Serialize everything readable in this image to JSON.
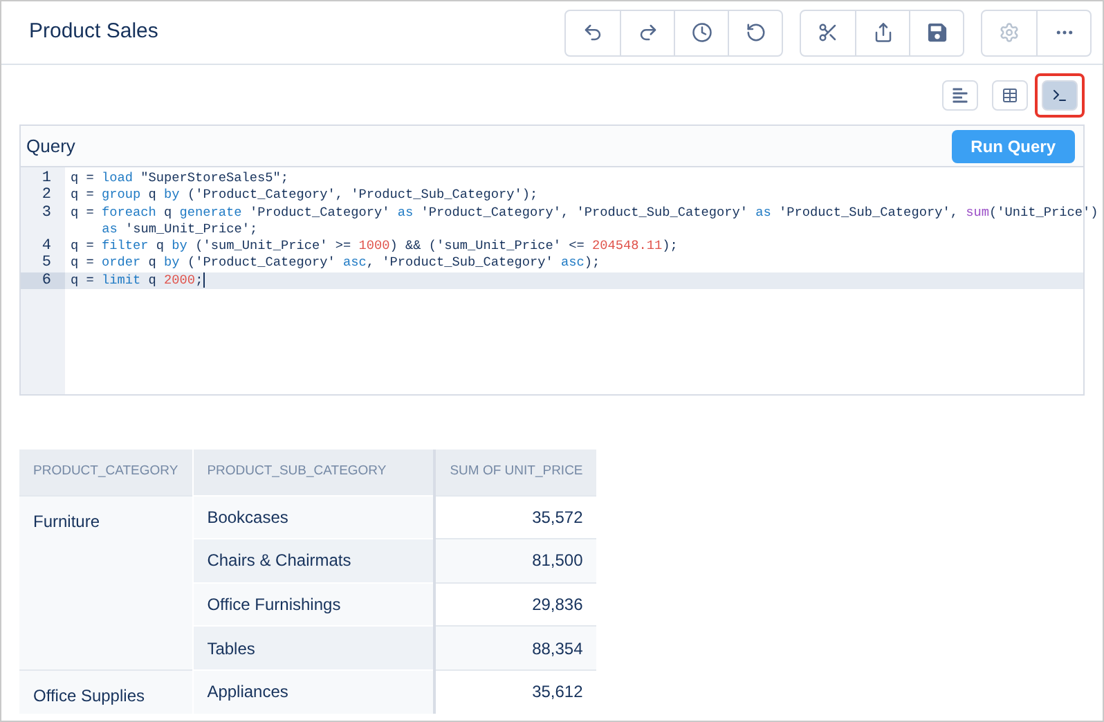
{
  "header": {
    "title": "Product Sales",
    "toolbar_groups": [
      [
        {
          "kind": "undo",
          "disabled": false
        },
        {
          "kind": "redo",
          "disabled": false
        },
        {
          "kind": "history",
          "disabled": false
        },
        {
          "kind": "revert",
          "disabled": false
        }
      ],
      [
        {
          "kind": "cut",
          "disabled": false
        },
        {
          "kind": "share",
          "disabled": false
        },
        {
          "kind": "save",
          "disabled": false
        }
      ],
      [
        {
          "kind": "settings",
          "disabled": true
        },
        {
          "kind": "more",
          "disabled": false
        }
      ]
    ]
  },
  "view_buttons": [
    {
      "kind": "chart",
      "selected": false,
      "highlighted": false
    },
    {
      "kind": "table",
      "selected": false,
      "highlighted": false
    },
    {
      "kind": "query",
      "selected": true,
      "highlighted": true
    }
  ],
  "query": {
    "title": "Query",
    "run_button": "Run Query",
    "lines": [
      {
        "number": "1",
        "active": false,
        "tokens": [
          {
            "text": "q = ",
            "kind": "plain"
          },
          {
            "text": "load",
            "kind": "keyword"
          },
          {
            "text": " \"SuperStoreSales5\";",
            "kind": "plain"
          }
        ]
      },
      {
        "number": "2",
        "active": false,
        "tokens": [
          {
            "text": "q = ",
            "kind": "plain"
          },
          {
            "text": "group",
            "kind": "keyword"
          },
          {
            "text": " q ",
            "kind": "plain"
          },
          {
            "text": "by",
            "kind": "keyword"
          },
          {
            "text": " ('Product_Category', 'Product_Sub_Category');",
            "kind": "plain"
          }
        ]
      },
      {
        "number": "3",
        "active": false,
        "tokens": [
          {
            "text": "q = ",
            "kind": "plain"
          },
          {
            "text": "foreach",
            "kind": "keyword"
          },
          {
            "text": " q ",
            "kind": "plain"
          },
          {
            "text": "generate",
            "kind": "keyword"
          },
          {
            "text": " 'Product_Category' ",
            "kind": "plain"
          },
          {
            "text": "as",
            "kind": "keyword"
          },
          {
            "text": " 'Product_Category', 'Product_Sub_Category' ",
            "kind": "plain"
          },
          {
            "text": "as",
            "kind": "keyword"
          },
          {
            "text": " 'Product_Sub_Category', ",
            "kind": "plain"
          },
          {
            "text": "sum",
            "kind": "function"
          },
          {
            "text": "('Unit_Price')",
            "kind": "plain"
          }
        ],
        "wrapped_tokens": [
          {
            "text": "as",
            "kind": "keyword"
          },
          {
            "text": " 'sum_Unit_Price';",
            "kind": "plain"
          }
        ]
      },
      {
        "number": "4",
        "active": false,
        "tokens": [
          {
            "text": "q = ",
            "kind": "plain"
          },
          {
            "text": "filter",
            "kind": "keyword"
          },
          {
            "text": " q ",
            "kind": "plain"
          },
          {
            "text": "by",
            "kind": "keyword"
          },
          {
            "text": " ('sum_Unit_Price' >= ",
            "kind": "plain"
          },
          {
            "text": "1000",
            "kind": "number"
          },
          {
            "text": ") && ('sum_Unit_Price' <= ",
            "kind": "plain"
          },
          {
            "text": "204548.11",
            "kind": "number"
          },
          {
            "text": ");",
            "kind": "plain"
          }
        ]
      },
      {
        "number": "5",
        "active": false,
        "tokens": [
          {
            "text": "q = ",
            "kind": "plain"
          },
          {
            "text": "order",
            "kind": "keyword"
          },
          {
            "text": " q ",
            "kind": "plain"
          },
          {
            "text": "by",
            "kind": "keyword"
          },
          {
            "text": " ('Product_Category' ",
            "kind": "plain"
          },
          {
            "text": "asc",
            "kind": "keyword"
          },
          {
            "text": ", 'Product_Sub_Category' ",
            "kind": "plain"
          },
          {
            "text": "asc",
            "kind": "keyword"
          },
          {
            "text": ");",
            "kind": "plain"
          }
        ]
      },
      {
        "number": "6",
        "active": true,
        "tokens": [
          {
            "text": "q = ",
            "kind": "plain"
          },
          {
            "text": "limit",
            "kind": "keyword"
          },
          {
            "text": " q ",
            "kind": "plain"
          },
          {
            "text": "2000",
            "kind": "number"
          },
          {
            "text": ";",
            "kind": "plain"
          }
        ]
      }
    ]
  },
  "table": {
    "columns": [
      "PRODUCT_CATEGORY",
      "PRODUCT_SUB_CATEGORY",
      "SUM OF UNIT_PRICE"
    ],
    "groups": [
      {
        "category": "Furniture",
        "rows": [
          {
            "sub_category": "Bookcases",
            "value": "35,572"
          },
          {
            "sub_category": "Chairs & Chairmats",
            "value": "81,500"
          },
          {
            "sub_category": "Office Furnishings",
            "value": "29,836"
          },
          {
            "sub_category": "Tables",
            "value": "88,354"
          }
        ]
      },
      {
        "category": "Office Supplies",
        "rows": [
          {
            "sub_category": "Appliances",
            "value": "35,612"
          }
        ]
      }
    ]
  }
}
